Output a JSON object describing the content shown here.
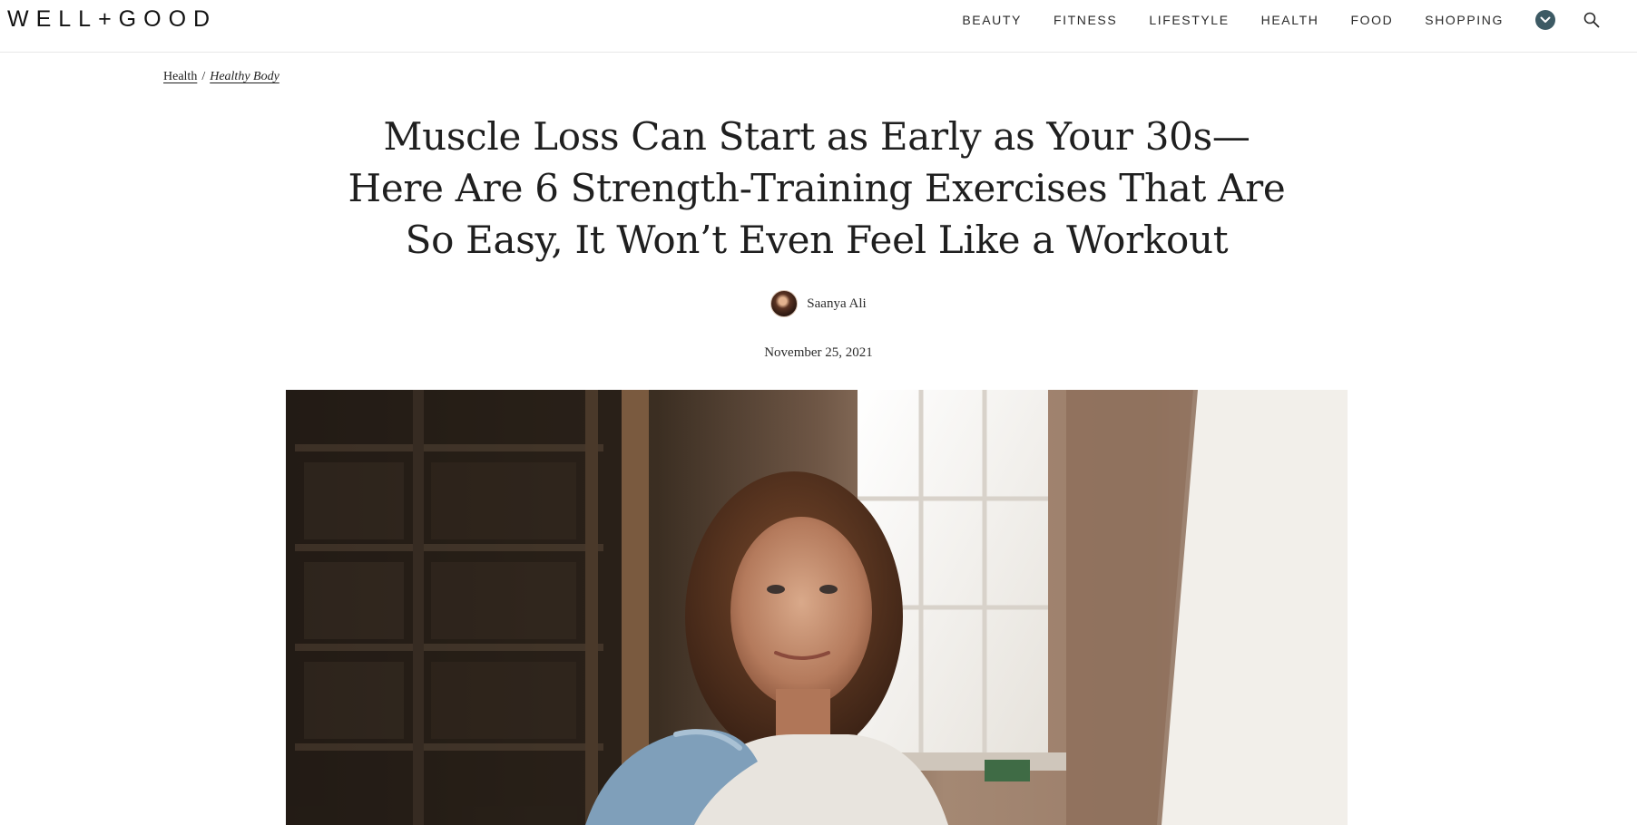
{
  "header": {
    "logo": "WELL+GOOD",
    "nav": [
      "BEAUTY",
      "FITNESS",
      "LIFESTYLE",
      "HEALTH",
      "FOOD",
      "SHOPPING"
    ],
    "icons": {
      "more": "chevron-down-icon",
      "search": "search-icon"
    },
    "accent_color": "#3d5a64"
  },
  "breadcrumb": {
    "parent": "Health",
    "separator": "/",
    "current": "Healthy Body"
  },
  "article": {
    "title": "Muscle Loss Can Start as Early as Your 30s—Here Are 6 Strength-Training Exercises That Are So Easy, It Won’t Even Feel Like a Workout",
    "author": "Saanya Ali",
    "date": "November 25, 2021"
  }
}
